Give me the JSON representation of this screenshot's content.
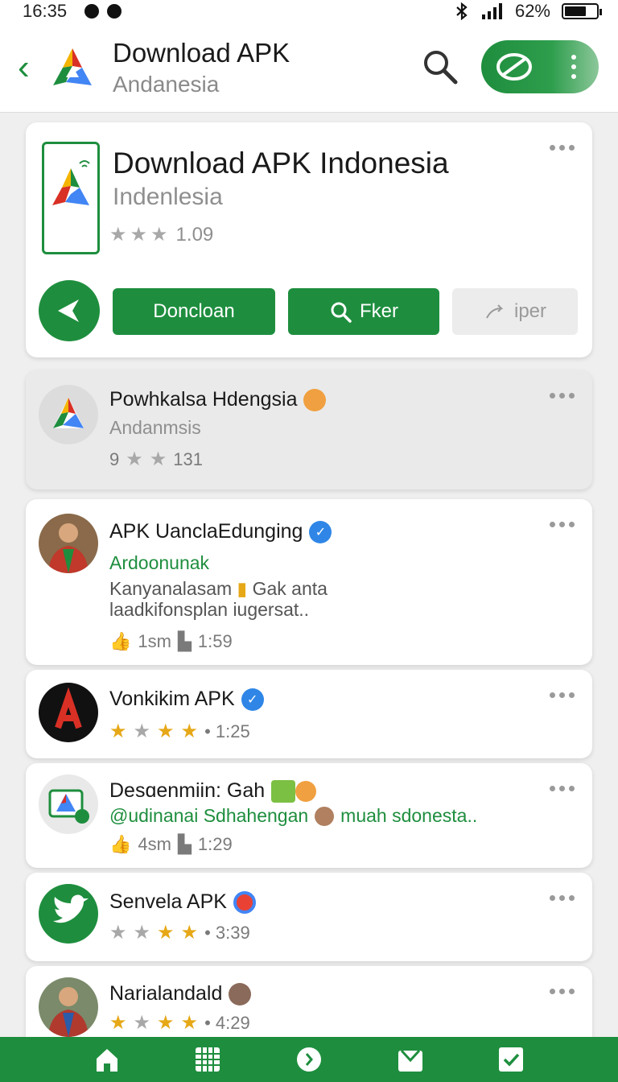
{
  "status": {
    "time": "16:35",
    "battery": "62%"
  },
  "appbar": {
    "title": "Download APK",
    "subtitle": "Andanesia"
  },
  "hero": {
    "name": "Download APK Indonesia",
    "subtitle": "Indenlesia",
    "rating_value": "1.09",
    "buttons": {
      "download": "Doncloan",
      "search": "Fker",
      "share": "iper"
    }
  },
  "featured": {
    "title": "Powhkalsa Hdengsia",
    "subtitle": "Andanmsis",
    "rating_count": "9",
    "reviews": "131"
  },
  "feed": [
    {
      "title": "APK UanclaEdunging",
      "handle": "Ardoonunak",
      "text_line1": "Kanyanalasam",
      "text_line1b": "Gak anta",
      "text_line2": "laadkifonsplan iugersat..",
      "likes": "1sm",
      "time": "1:59"
    },
    {
      "title": "Vonkikim APK",
      "time": "• 1:25"
    },
    {
      "title": "Desɑenmiin: Gah",
      "handle": "@udinanai Sdhahengan",
      "handle2": "muah sdonesta..",
      "likes": "4sm",
      "time": "1:29"
    },
    {
      "title": "Senvela APK",
      "time": "• 3:39"
    },
    {
      "title": "Narialandald",
      "time": "• 4:29"
    }
  ],
  "colors": {
    "accent": "#1e8e3e",
    "verified": "#2f86e6",
    "star": "#e6a817"
  },
  "icons": [
    "back-icon",
    "app-logo-icon",
    "search-icon",
    "leaf-icon",
    "more-icon",
    "star-icon",
    "like-icon",
    "time-icon",
    "home-icon",
    "grid-icon",
    "compass-icon",
    "mail-icon",
    "check-icon"
  ]
}
